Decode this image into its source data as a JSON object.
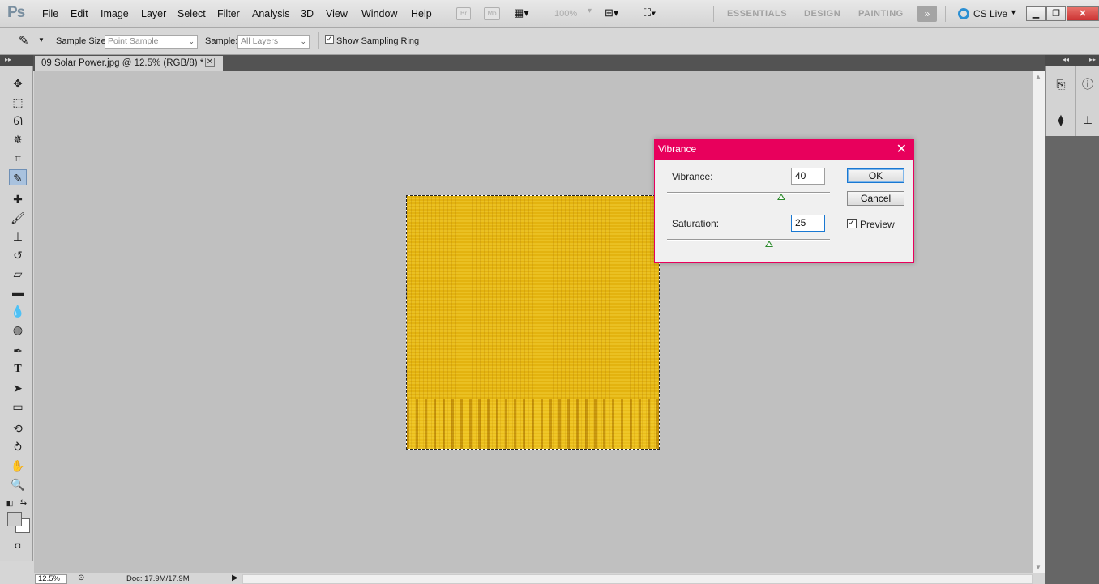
{
  "app": {
    "logo": "Ps",
    "menu": [
      "File",
      "Edit",
      "Image",
      "Layer",
      "Select",
      "Filter",
      "Analysis",
      "3D",
      "View",
      "Window",
      "Help"
    ],
    "bridge_label": "Br",
    "minibridge_label": "Mb",
    "zoom_menu": "100%",
    "workspaces": [
      "ESSENTIALS",
      "DESIGN",
      "PAINTING"
    ],
    "more_workspaces": "»",
    "cs_live": "CS Live"
  },
  "options": {
    "sample_size_label": "Sample Size:",
    "sample_size_value": "Point Sample",
    "sample_label": "Sample:",
    "sample_value": "All Layers",
    "show_ring_label": "Show Sampling Ring",
    "show_ring_checked": "✓"
  },
  "document": {
    "tab_title": "09 Solar Power.jpg @ 12.5% (RGB/8) *",
    "tab_close": "✕"
  },
  "status": {
    "zoom": "12.5%",
    "doc_info": "Doc: 17.9M/17.9M"
  },
  "dialog": {
    "title": "Vibrance",
    "close": "✕",
    "vibrance_label": "Vibrance:",
    "vibrance_value": "40",
    "vibrance_level": 0.7,
    "saturation_label": "Saturation:",
    "saturation_value": "25",
    "saturation_level": 0.625,
    "ok_label": "OK",
    "cancel_label": "Cancel",
    "preview_label": "Preview",
    "preview_checked": "✓"
  },
  "colors": {
    "dialog_accent": "#e8005c",
    "image_fill": "#e3b30f"
  }
}
